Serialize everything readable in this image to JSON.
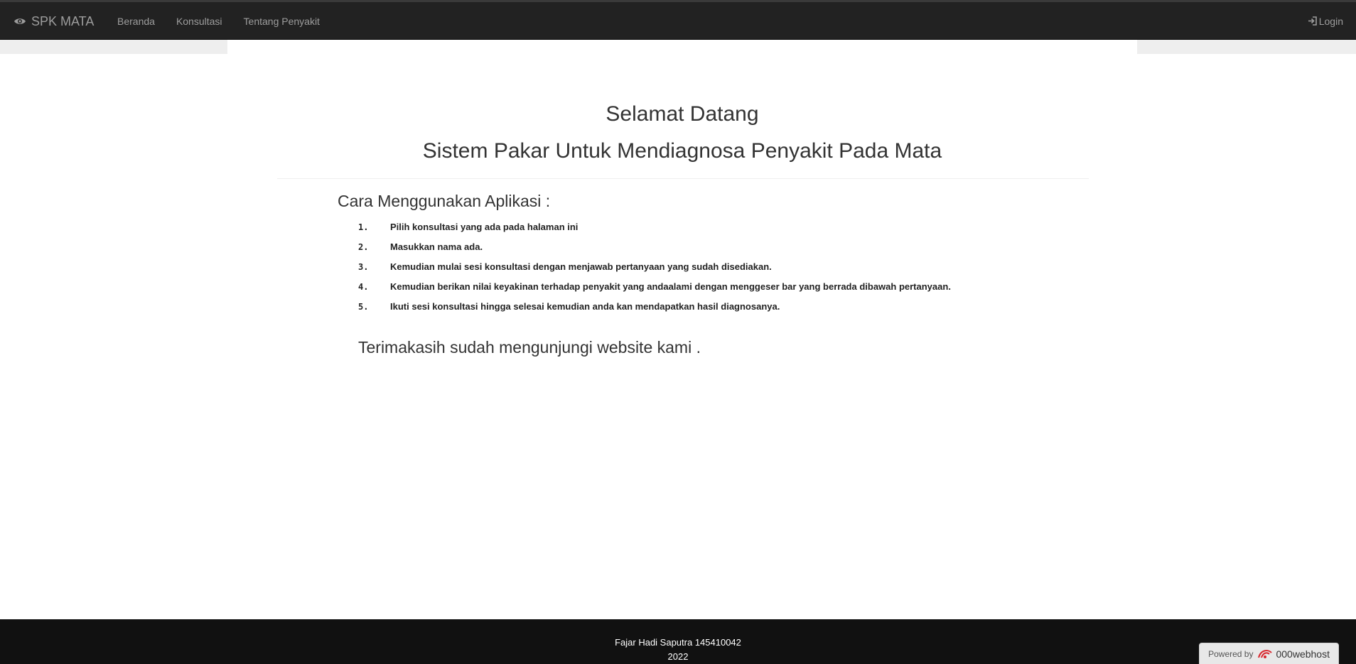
{
  "navbar": {
    "brand": "SPK MATA",
    "brand_icon": "eye-icon",
    "links": [
      {
        "label": "Beranda"
      },
      {
        "label": "Konsultasi"
      },
      {
        "label": "Tentang Penyakit"
      }
    ],
    "login": "Login",
    "login_icon": "login-icon"
  },
  "main": {
    "welcome": "Selamat Datang",
    "system_title": "Sistem Pakar Untuk Mendiagnosa Penyakit Pada Mata",
    "howto_title": "Cara Menggunakan Aplikasi :",
    "steps": [
      {
        "num": "1.",
        "text": "Pilih konsultasi yang ada pada halaman ini"
      },
      {
        "num": "2.",
        "text": "Masukkan nama ada."
      },
      {
        "num": "3.",
        "text": "Kemudian mulai sesi konsultasi dengan menjawab pertanyaan yang sudah disediakan."
      },
      {
        "num": "4.",
        "text": "Kemudian berikan nilai keyakinan terhadap penyakit yang andaalami dengan menggeser bar yang berrada dibawah pertanyaan."
      },
      {
        "num": "5.",
        "text": "Ikuti sesi konsultasi hingga selesai kemudian anda kan mendapatkan hasil diagnosanya."
      }
    ],
    "thanks": "Terimakasih sudah mengunjungi website kami ."
  },
  "footer": {
    "author": "Fajar Hadi Saputra 145410042",
    "year": "2022",
    "badge_powered": "Powered by",
    "badge_brand": "000webhost"
  },
  "colors": {
    "navbar_bg": "#222222",
    "footer_bg": "#111111",
    "nav_text": "#9d9d9d",
    "badge_logo": "#d9262c"
  }
}
